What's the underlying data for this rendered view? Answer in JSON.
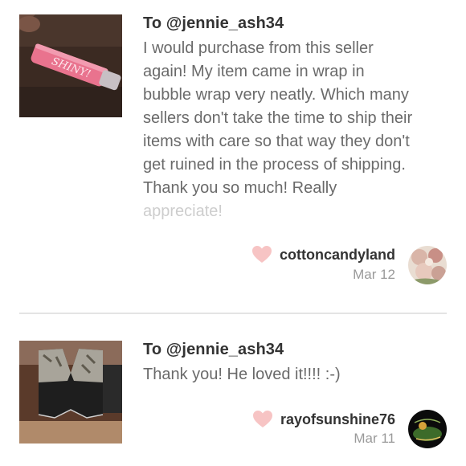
{
  "reviews": [
    {
      "recipient": "To @jennie_ash34",
      "thumb_icon": "lip-gloss-tube-photo",
      "text_lines": [
        "I would purchase from this seller",
        "again! My item came in wrap in",
        "bubble wrap very neatly. Which many",
        "sellers don't take the time to ship their",
        "items with care so that way they don't",
        "get ruined in the process of shipping.",
        "Thank you so much! Really",
        "appreciate!"
      ],
      "author": "cottoncandyland",
      "date": "Mar 12",
      "heart_color": "#f7c4c4"
    },
    {
      "recipient": "To @jennie_ash34",
      "thumb_icon": "camo-vest-photo",
      "text_lines": [
        "Thank you! He loved it!!!! :-)"
      ],
      "author": "rayofsunshine76",
      "date": "Mar 11",
      "heart_color": "#f7c4c4"
    }
  ],
  "colors": {
    "title": "#333333",
    "body": "#6a6a6a",
    "date": "#9a9a9a",
    "divider": "#e4e4e4"
  }
}
